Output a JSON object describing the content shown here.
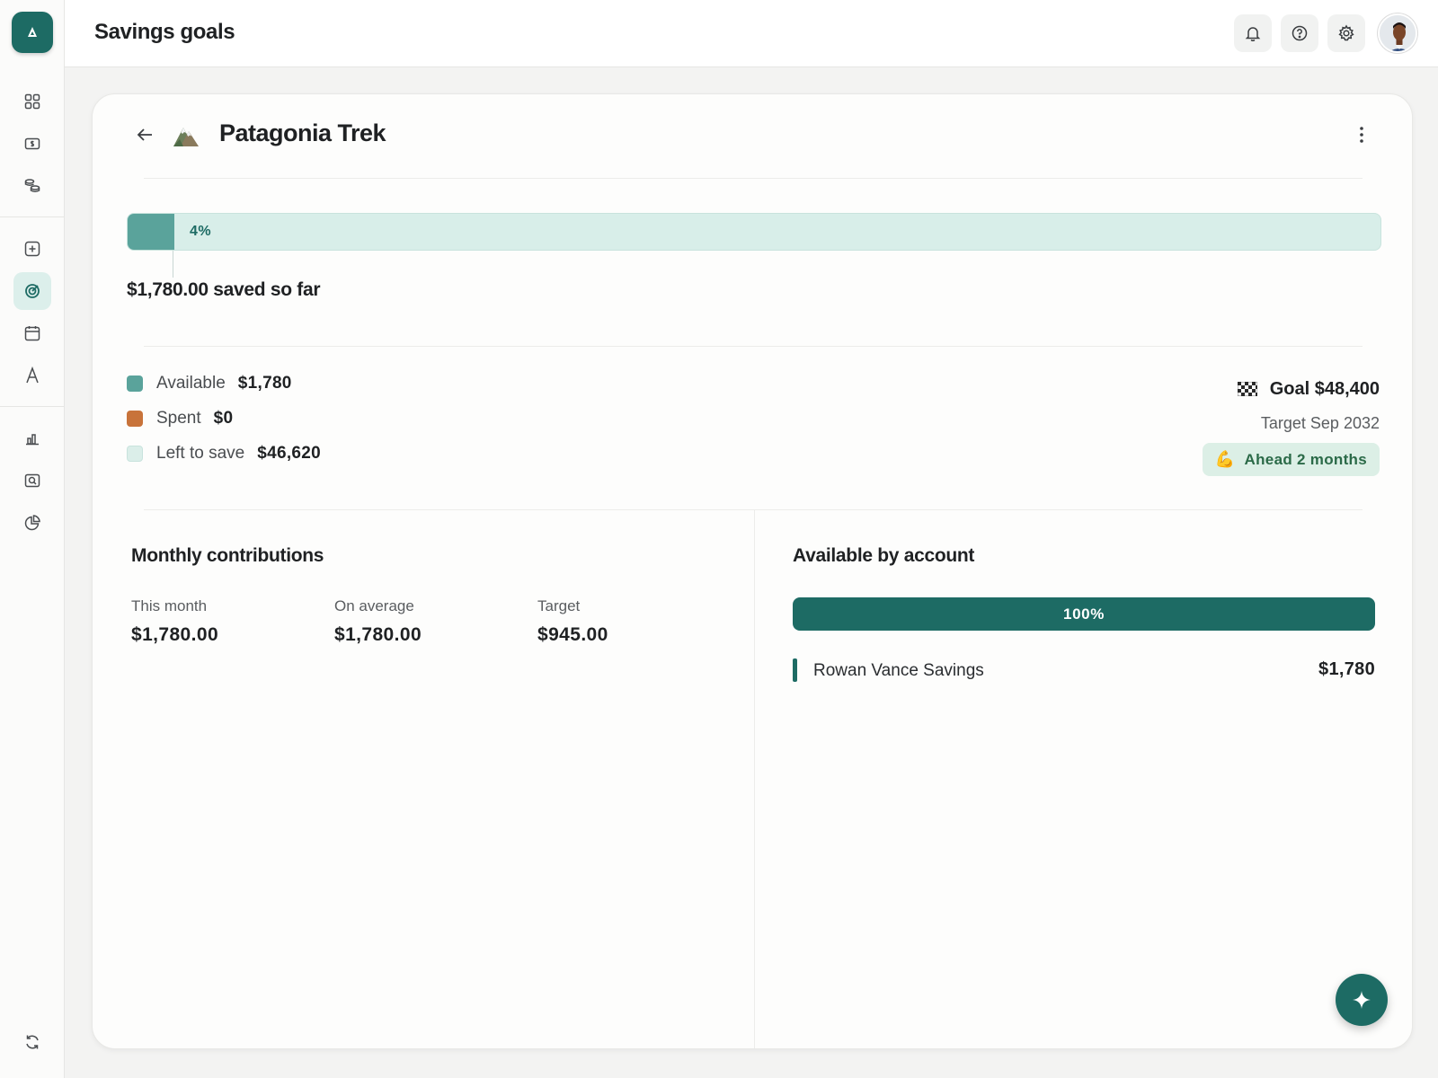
{
  "app": {
    "page_title": "Savings goals",
    "logo_icon": "logo-icon"
  },
  "sidebar": {
    "items": [
      {
        "name": "dashboard",
        "icon": "grid-icon",
        "active": false
      },
      {
        "name": "accounts",
        "icon": "dollar-icon",
        "active": false
      },
      {
        "name": "transactions",
        "icon": "coins-icon",
        "active": false
      },
      {
        "name": "add",
        "icon": "plus-square-icon",
        "active": false
      },
      {
        "name": "goals",
        "icon": "target-icon",
        "active": true
      },
      {
        "name": "calendar",
        "icon": "calendar-icon",
        "active": false
      },
      {
        "name": "advisor",
        "icon": "letter-a-icon",
        "active": false
      },
      {
        "name": "reports",
        "icon": "bar-chart-icon",
        "active": false
      },
      {
        "name": "search",
        "icon": "search-icon",
        "active": false
      },
      {
        "name": "budget",
        "icon": "pie-chart-icon",
        "active": false
      },
      {
        "name": "sync",
        "icon": "refresh-icon",
        "active": false
      }
    ]
  },
  "topbar": {
    "icons": [
      "bell-icon",
      "help-icon",
      "gear-icon"
    ]
  },
  "goal": {
    "name": "Patagonia Trek",
    "emoji_icon": "mountain-icon",
    "progress_percent_label": "4%",
    "progress_fraction": 0.037,
    "saved_text": "$1,780.00 saved so far",
    "goal_text": "Goal $48,400",
    "target_text": "Target Sep 2032",
    "status_text": "Ahead 2 months",
    "status_emoji": "💪"
  },
  "legend": [
    {
      "label": "Available",
      "value": "$1,780",
      "color": "#5aa39b"
    },
    {
      "label": "Spent",
      "value": "$0",
      "color": "#c8733a"
    },
    {
      "label": "Left to save",
      "value": "$46,620",
      "color": "#dbeee9"
    }
  ],
  "contributions": {
    "title": "Monthly contributions",
    "stats": [
      {
        "label": "This month",
        "value": "$1,780.00"
      },
      {
        "label": "On average",
        "value": "$1,780.00"
      },
      {
        "label": "Target",
        "value": "$945.00"
      }
    ]
  },
  "accounts": {
    "title": "Available by account",
    "bar_label": "100%",
    "items": [
      {
        "name": "Rowan Vance Savings",
        "amount": "$1,780"
      }
    ]
  },
  "colors": {
    "accent": "#1d6b64",
    "progress_fill": "#5aa39b",
    "progress_track": "#d8eee9",
    "badge_bg": "#dcefe6",
    "badge_text": "#2b6a48"
  }
}
